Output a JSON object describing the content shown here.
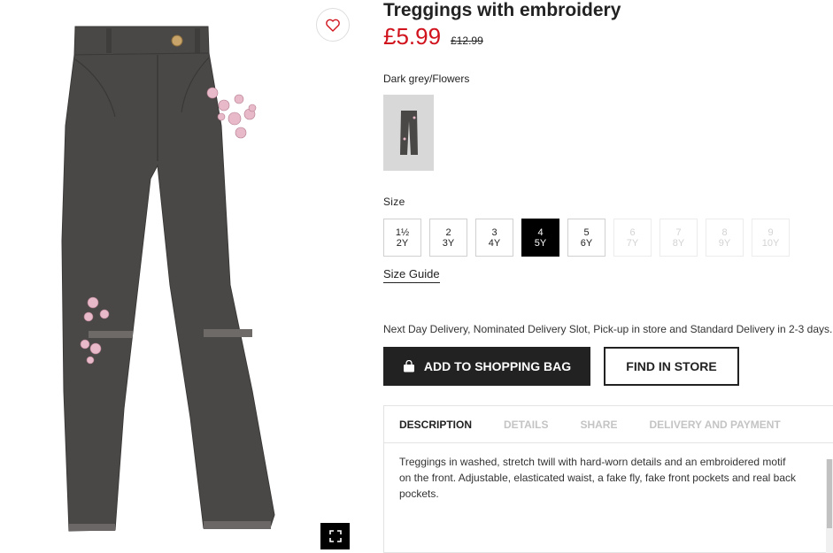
{
  "product": {
    "title": "Treggings with embroidery",
    "price_sale": "£5.99",
    "price_old": "£12.99",
    "color_name": "Dark grey/Flowers"
  },
  "size_section": {
    "label": "Size",
    "sizes": [
      {
        "line1": "1½",
        "line2": "2Y",
        "state": "available"
      },
      {
        "line1": "2",
        "line2": "3Y",
        "state": "available"
      },
      {
        "line1": "3",
        "line2": "4Y",
        "state": "available"
      },
      {
        "line1": "4",
        "line2": "5Y",
        "state": "selected"
      },
      {
        "line1": "5",
        "line2": "6Y",
        "state": "available"
      },
      {
        "line1": "6",
        "line2": "7Y",
        "state": "unavailable"
      },
      {
        "line1": "7",
        "line2": "8Y",
        "state": "unavailable"
      },
      {
        "line1": "8",
        "line2": "9Y",
        "state": "unavailable"
      },
      {
        "line1": "9",
        "line2": "10Y",
        "state": "unavailable"
      }
    ],
    "guide_label": "Size Guide"
  },
  "delivery_note": "Next Day Delivery, Nominated Delivery Slot, Pick-up in store and Standard Delivery in 2-3 days.",
  "actions": {
    "add_to_bag": "ADD TO SHOPPING BAG",
    "find_in_store": "FIND IN STORE"
  },
  "info_tabs": {
    "tabs": [
      "DESCRIPTION",
      "DETAILS",
      "SHARE",
      "DELIVERY AND PAYMENT"
    ],
    "active_tab": "DESCRIPTION",
    "description": "Treggings in washed, stretch twill with hard-worn details and an embroidered motif on the front. Adjustable, elasticated waist, a fake fly, fake front pockets and real back pockets."
  },
  "icons": {
    "favorite": "heart-icon",
    "fullscreen": "expand-icon",
    "bag": "shopping-bag-icon"
  },
  "colors": {
    "sale_price": "#d0131d",
    "primary_button": "#222222",
    "selected_size": "#000000",
    "heart": "#d0131d",
    "jeans": "#4a4847"
  }
}
